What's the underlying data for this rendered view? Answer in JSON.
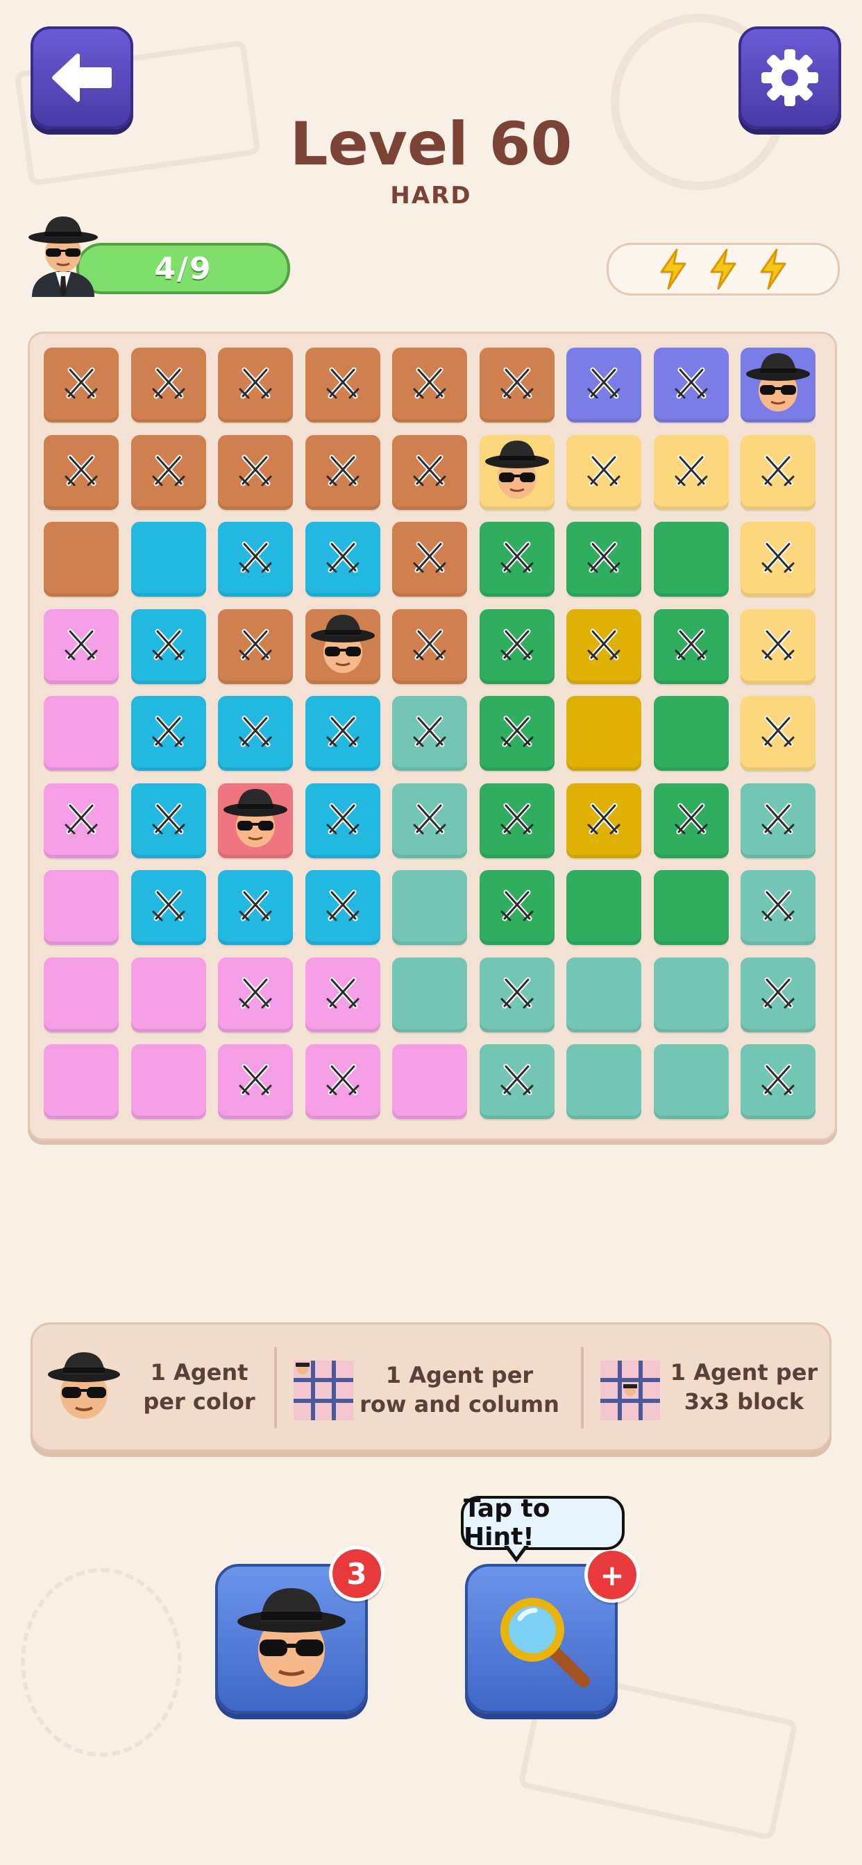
{
  "header": {
    "title": "Level 60",
    "difficulty": "HARD",
    "progress": "4/9",
    "progress_found": 4,
    "progress_total": 9,
    "lightning_count": 3
  },
  "colors": {
    "brown": "#d0804f",
    "purple": "#7b7de6",
    "yellow": "#fcd77d",
    "cyan": "#22b8e0",
    "green": "#2fae60",
    "pink": "#f49ee5",
    "gold": "#dfb106",
    "teal": "#72c6b3",
    "red": "#ef7580"
  },
  "grid": {
    "rows": 9,
    "cols": 9,
    "cells": [
      [
        "brown",
        "brown",
        "brown",
        "brown",
        "brown",
        "brown",
        "purple",
        "purple",
        "purple"
      ],
      [
        "brown",
        "brown",
        "brown",
        "brown",
        "brown",
        "yellow",
        "yellow",
        "yellow",
        "yellow"
      ],
      [
        "brown",
        "cyan",
        "cyan",
        "cyan",
        "brown",
        "green",
        "green",
        "green",
        "yellow"
      ],
      [
        "pink",
        "cyan",
        "brown",
        "brown",
        "brown",
        "green",
        "gold",
        "green",
        "yellow"
      ],
      [
        "pink",
        "cyan",
        "cyan",
        "cyan",
        "teal",
        "green",
        "gold",
        "green",
        "yellow"
      ],
      [
        "pink",
        "cyan",
        "red",
        "cyan",
        "teal",
        "green",
        "gold",
        "green",
        "teal"
      ],
      [
        "pink",
        "cyan",
        "cyan",
        "cyan",
        "teal",
        "green",
        "green",
        "green",
        "teal"
      ],
      [
        "pink",
        "pink",
        "pink",
        "pink",
        "teal",
        "teal",
        "teal",
        "teal",
        "teal"
      ],
      [
        "pink",
        "pink",
        "pink",
        "pink",
        "pink",
        "teal",
        "teal",
        "teal",
        "teal"
      ]
    ],
    "marks": [
      [
        "x",
        "x",
        "x",
        "x",
        "x",
        "x",
        "x",
        "x",
        "agent"
      ],
      [
        "x",
        "x",
        "x",
        "x",
        "x",
        "agent",
        "x",
        "x",
        "x"
      ],
      [
        "",
        "",
        "x",
        "x",
        "x",
        "x",
        "x",
        "",
        "x"
      ],
      [
        "x",
        "x",
        "x",
        "agent",
        "x",
        "x",
        "x",
        "x",
        "x"
      ],
      [
        "",
        "x",
        "x",
        "x",
        "x",
        "x",
        "",
        "",
        "x"
      ],
      [
        "x",
        "x",
        "agent",
        "x",
        "x",
        "x",
        "x",
        "x",
        "x"
      ],
      [
        "",
        "x",
        "x",
        "x",
        "",
        "x",
        "",
        "",
        "x"
      ],
      [
        "",
        "",
        "x",
        "x",
        "",
        "x",
        "",
        "",
        "x"
      ],
      [
        "",
        "",
        "x",
        "x",
        "",
        "x",
        "",
        "",
        "x"
      ]
    ]
  },
  "rules": [
    {
      "line1": "1 Agent",
      "line2": "per color",
      "icon": "agent-icon"
    },
    {
      "line1": "1 Agent per",
      "line2": "row and column",
      "icon": "grid-row-column-icon"
    },
    {
      "line1": "1 Agent per",
      "line2": "3x3 block",
      "icon": "grid-block-icon"
    }
  ],
  "buttons": {
    "agent_count": "3",
    "hint_badge": "+",
    "hint_tooltip": "Tap to Hint!"
  }
}
